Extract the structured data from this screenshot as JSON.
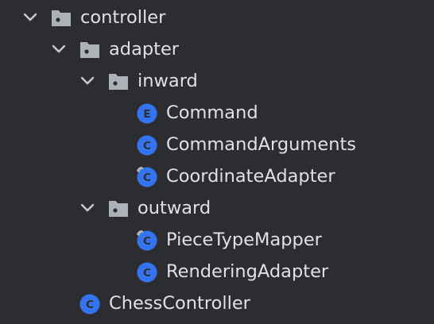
{
  "tree": {
    "nodes": [
      {
        "label": "controller",
        "kind": "package",
        "expanded": true,
        "icon": "package-folder-icon"
      },
      {
        "label": "adapter",
        "kind": "package",
        "expanded": true,
        "icon": "package-folder-icon"
      },
      {
        "label": "inward",
        "kind": "package",
        "expanded": true,
        "icon": "package-folder-icon"
      },
      {
        "label": "Command",
        "kind": "enum",
        "icon_letter": "E",
        "icon": "enum-icon"
      },
      {
        "label": "CommandArguments",
        "kind": "class",
        "icon_letter": "C",
        "icon": "class-icon"
      },
      {
        "label": "CoordinateAdapter",
        "kind": "class",
        "icon_letter": "C",
        "icon": "class-icon",
        "modifier": "modified-overlay"
      },
      {
        "label": "outward",
        "kind": "package",
        "expanded": true,
        "icon": "package-folder-icon"
      },
      {
        "label": "PieceTypeMapper",
        "kind": "class",
        "icon_letter": "C",
        "icon": "class-icon",
        "modifier": "modified-overlay"
      },
      {
        "label": "RenderingAdapter",
        "kind": "class",
        "icon_letter": "C",
        "icon": "class-icon"
      },
      {
        "label": "ChessController",
        "kind": "class",
        "icon_letter": "C",
        "icon": "class-icon"
      }
    ]
  },
  "colors": {
    "background": "#2b2d30",
    "text": "#dfe1e5",
    "folder": "#aeb1b8",
    "chevron": "#c9ccd1",
    "class_icon": "#3574f0",
    "icon_letter": "#2b2d30"
  }
}
